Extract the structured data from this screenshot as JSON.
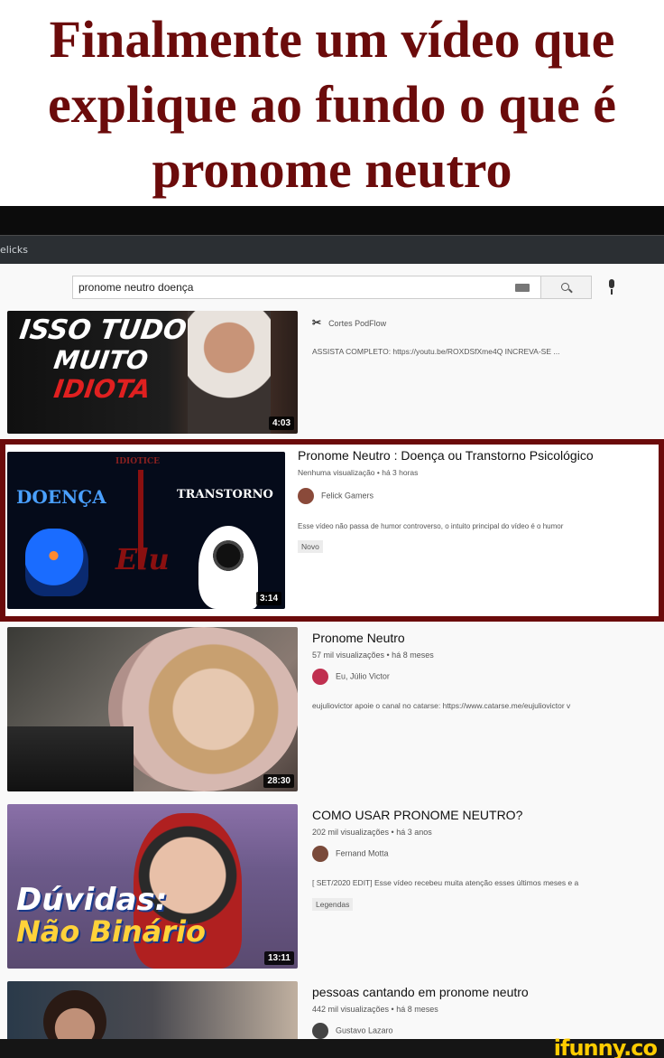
{
  "meme": {
    "caption_line1": "Finalmente um vídeo que",
    "caption_line2": "explique ao fundo o que é",
    "caption_line3": "pronome neutro",
    "watermark": "ifunny.co"
  },
  "browser": {
    "tab_title": "elicks"
  },
  "search": {
    "query": "pronome neutro doença",
    "keyboard_icon": "keyboard-icon",
    "search_icon": "search-icon",
    "mic_icon": "microphone-icon"
  },
  "results": [
    {
      "thumb_text": [
        "ISSO TUDO",
        "MUITO",
        "IDIOTA"
      ],
      "duration": "4:03",
      "channel": "Cortes PodFlow",
      "description": "ASSISTA COMPLETO: https://youtu.be/ROXDSfXme4Q INCREVA-SE ..."
    },
    {
      "title": "Pronome Neutro : Doença ou Transtorno Psicológico",
      "meta": "Nenhuma visualização • há 3 horas",
      "channel": "Felick Gamers",
      "description": "Esse vídeo não passa de humor controverso, o intuito principal do vídeo é o humor",
      "badge": "Novo",
      "duration": "3:14",
      "thumb_labels": [
        "IDIOTICE",
        "DOENÇA",
        "TRANSTORNO",
        "Elu"
      ]
    },
    {
      "title": "Pronome Neutro",
      "meta": "57 mil visualizações • há 8 meses",
      "channel": "Eu, Júlio Victor",
      "description": "eujuliovictor apoie o canal no catarse: https://www.catarse.me/eujuliovictor v",
      "duration": "28:30"
    },
    {
      "title": "COMO USAR PRONOME NEUTRO?",
      "meta": "202 mil visualizações • há 3 anos",
      "channel": "Fernand Motta",
      "description": "[ SET/2020 EDIT] Esse vídeo recebeu muita atenção esses últimos meses e a",
      "badge": "Legendas",
      "duration": "13:11",
      "thumb_labels": [
        "Dúvidas:",
        "Não Binário"
      ]
    },
    {
      "title": "pessoas cantando em pronome neutro",
      "meta": "442 mil visualizações • há 8 meses",
      "channel": "Gustavo Lazaro"
    }
  ],
  "colors": {
    "caption": "#6b0b0b",
    "highlight_border": "#6b0b0b",
    "ifunny_logo": "#ffcc00"
  }
}
